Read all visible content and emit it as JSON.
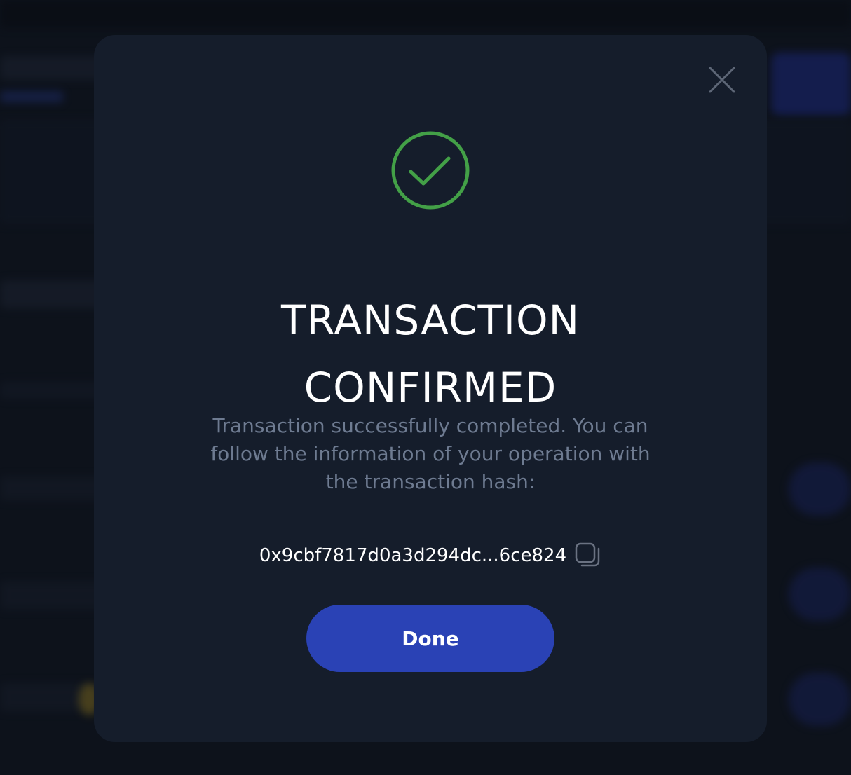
{
  "modal": {
    "title_line1": "TRANSACTION",
    "title_line2": "CONFIRMED",
    "description": "Transaction successfully completed. You can follow the information of your operation with the transaction hash:",
    "transaction_hash": "0x9cbf7817d0a3d294dc...6ce824",
    "done_label": "Done",
    "icons": {
      "status": "check-circle-icon",
      "close": "close-icon",
      "copy": "copy-icon"
    }
  },
  "colors": {
    "modal_background": "#151d2b",
    "success_green": "#43a047",
    "primary_button": "#2a42b5",
    "description_text": "#6e7b91"
  }
}
